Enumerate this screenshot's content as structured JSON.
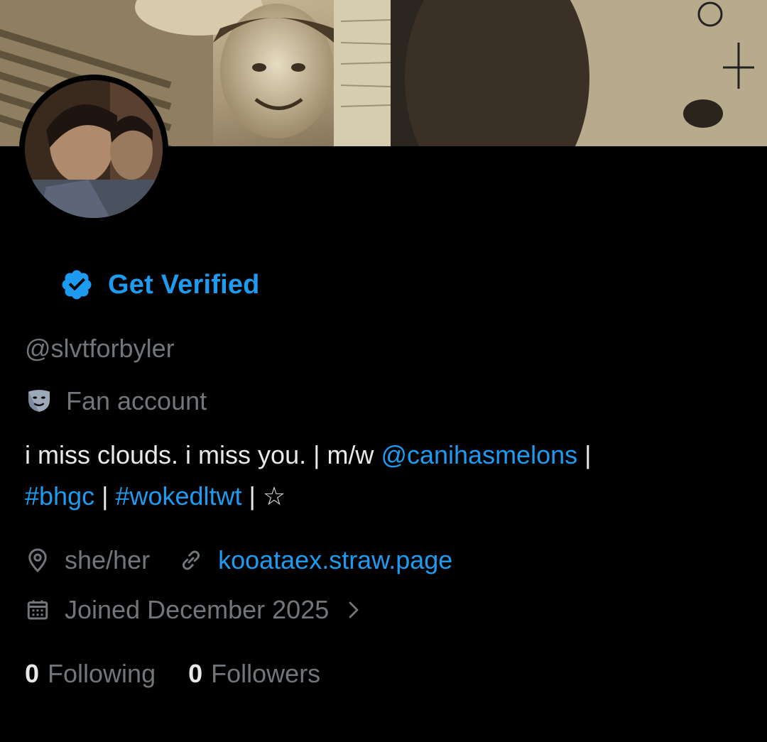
{
  "profile": {
    "verify_label": "Get Verified",
    "handle": "@slvtforbyler",
    "category": "Fan account",
    "bio": {
      "text1": "i miss clouds. i miss you. | m/w ",
      "mention": "@canihasmelons",
      "sep1": " |",
      "hashtag1": "#bhgc",
      "sep2": " | ",
      "hashtag2": "#wokedltwt",
      "sep3": " | ",
      "star": "☆"
    },
    "location": "she/her",
    "website": "kooataex.straw.page",
    "joined": "Joined December 2025",
    "following_count": "0",
    "following_label": "Following",
    "followers_count": "0",
    "followers_label": "Followers"
  },
  "icons": {
    "verified": "verified-badge-icon",
    "category": "theater-masks-icon",
    "location": "location-pin-icon",
    "link": "link-icon",
    "calendar": "calendar-icon",
    "chevron": "chevron-right-icon"
  },
  "colors": {
    "background": "#000000",
    "accent": "#1d9bf0",
    "primary_text": "#e7e9ea",
    "secondary_text": "#71767b"
  }
}
